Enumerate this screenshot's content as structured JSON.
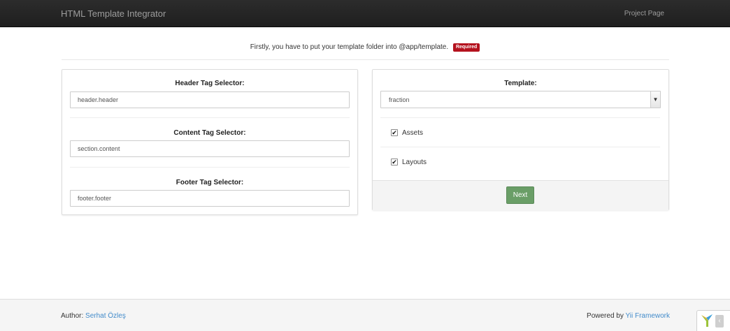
{
  "navbar": {
    "brand": "HTML Template Integrator",
    "project_link": "Project Page"
  },
  "intro": {
    "text": "Firstly, you have to put your template folder into @app/template.",
    "badge": "Required"
  },
  "selectors_form": {
    "header_label": "Header Tag Selector:",
    "header_value": "header.header",
    "content_label": "Content Tag Selector:",
    "content_value": "section.content",
    "footer_label": "Footer Tag Selector:",
    "footer_value": "footer.footer"
  },
  "template_form": {
    "template_label": "Template:",
    "template_selected": "fraction",
    "options": [
      {
        "label": "Assets",
        "checked": true
      },
      {
        "label": "Layouts",
        "checked": true
      }
    ],
    "next_label": "Next"
  },
  "footer": {
    "author_prefix": "Author:",
    "author_name": "Serhat Özleş",
    "powered_prefix": "Powered by",
    "powered_link": "Yii Framework"
  },
  "colors": {
    "navbar_bg": "#222222",
    "required_badge": "#b4121e",
    "next_button": "#6a9e67",
    "link": "#428bca"
  },
  "icons": {
    "select_arrow": "chevron-down-icon",
    "checkbox_mark": "checkmark-icon",
    "yii_logo": "yii-logo-icon",
    "debug_toggle": "chevron-left-icon"
  }
}
